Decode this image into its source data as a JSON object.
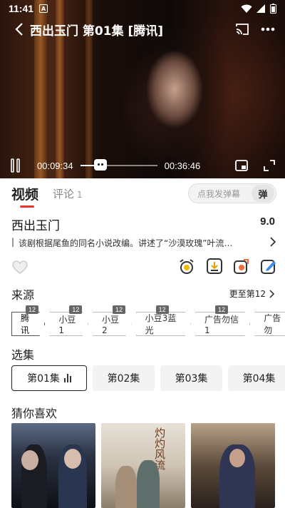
{
  "status_bar": {
    "time": "11:41",
    "app_icon": "A"
  },
  "player": {
    "title": "西出玉门 第01集 [腾讯]",
    "current_time": "00:09:34",
    "total_time": "00:36:46",
    "progress": 0.26
  },
  "tabs": {
    "video": "视频",
    "comment": "评论",
    "comment_count": "1"
  },
  "danmaku": {
    "placeholder": "点我发弹幕",
    "button": "弹"
  },
  "show": {
    "title": "西出玉门",
    "score": "9.0",
    "description": "该剧根据尾鱼的同名小说改编。讲述了“沙漠玫瑰”叶流…"
  },
  "source": {
    "heading": "来源",
    "more": "更至第12",
    "items": [
      {
        "label": "腾讯",
        "badge": "12"
      },
      {
        "label": "小豆1",
        "badge": "12"
      },
      {
        "label": "小豆2",
        "badge": "12"
      },
      {
        "label": "小豆3蓝光",
        "badge": "12"
      },
      {
        "label": "广告勿信1",
        "badge": "12"
      },
      {
        "label": "广告勿",
        "badge": ""
      }
    ]
  },
  "episodes": {
    "heading": "选集",
    "items": [
      "第01集",
      "第02集",
      "第03集",
      "第04集"
    ]
  },
  "recommend": {
    "heading": "猜你喜欢",
    "poster_text": "灼灼风流"
  },
  "colors": {
    "accent": "#e8322b",
    "player_bg": "#1a0d08"
  }
}
